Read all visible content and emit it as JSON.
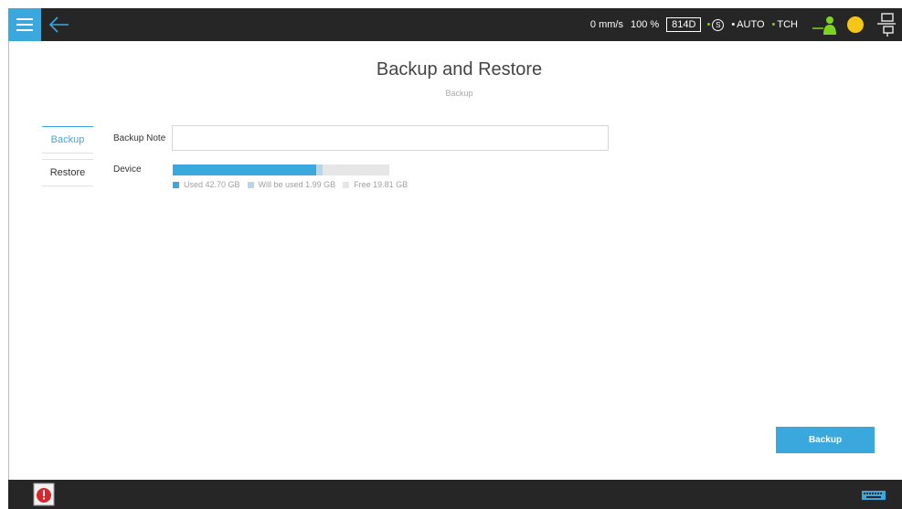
{
  "topbar": {
    "menu_icon": "hamburger-menu-icon",
    "back_icon": "back-arrow-icon",
    "speed": "0 mm/s",
    "override": "100 %",
    "tool": "814D",
    "servo_symbol": "S",
    "mode": "AUTO",
    "frame": "TCH",
    "robot_icon": "robot-user-icon",
    "status_icon": "yellow-status-dot-icon",
    "io_icon": "io-connector-icon",
    "colors": {
      "accent": "#3aa8dd",
      "green": "#7ed321",
      "yellow": "#f5c518"
    }
  },
  "page": {
    "title": "Backup and Restore",
    "subtitle": "Backup"
  },
  "tabs": [
    {
      "label": "Backup",
      "active": true
    },
    {
      "label": "Restore",
      "active": false
    }
  ],
  "form": {
    "note_label": "Backup Note",
    "note_value": "",
    "device_label": "Device",
    "storage": {
      "used": 42.7,
      "will_be_used": 1.99,
      "free": 19.81,
      "used_label": "Used 42.70 GB",
      "will_label": "Will be used 1.99 GB",
      "free_label": "Free 19.81 GB",
      "colors": {
        "used": "#3aa8dd",
        "will": "#b9d5e6",
        "free": "#e6e6e6"
      }
    }
  },
  "actions": {
    "backup_label": "Backup"
  },
  "bottombar": {
    "alarm_icon": "alarm-warning-icon",
    "keyboard_icon": "keyboard-icon"
  }
}
